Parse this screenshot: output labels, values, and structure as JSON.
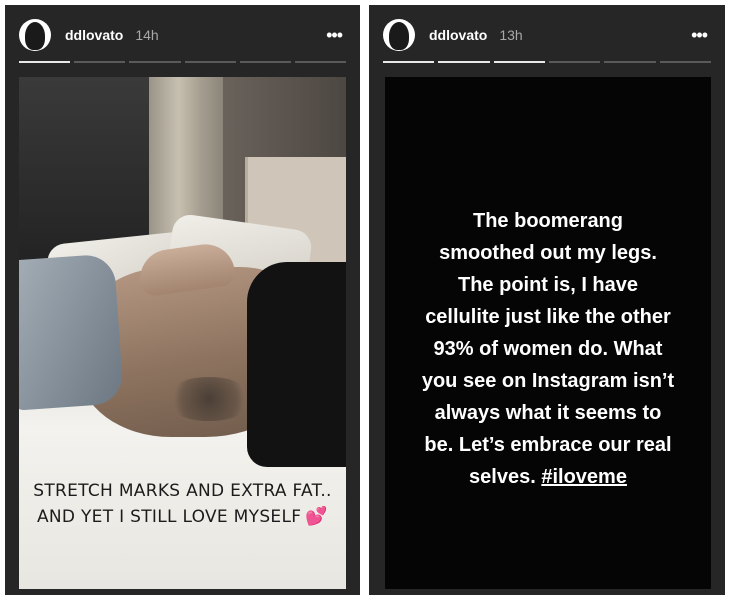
{
  "stories": [
    {
      "username": "ddlovato",
      "timestamp": "14h",
      "more_icon": "more-horizontal-icon",
      "progress": {
        "segments": 6,
        "active": 1
      },
      "caption_lines": [
        "STRETCH MARKS AND EXTRA FAT..",
        "AND YET I STILL LOVE MYSELF"
      ],
      "emoji_icon": "two-hearts-icon"
    },
    {
      "username": "ddlovato",
      "timestamp": "13h",
      "more_icon": "more-horizontal-icon",
      "progress": {
        "segments": 6,
        "active": 3
      },
      "text_lines": [
        "The boomerang",
        "smoothed out my legs.",
        "The point is, I have",
        "cellulite just like the other",
        "93% of women do. What",
        "you see on Instagram isn’t",
        "always what it seems to",
        "be. Let’s embrace our real"
      ],
      "last_line_prefix": "selves. ",
      "hashtag": "#iloveme"
    }
  ],
  "colors": {
    "panel_bg": "#262626",
    "progress_active": "#e8e8e8",
    "progress_inactive": "#5a5a5a",
    "heart": "#ff4fa3"
  }
}
